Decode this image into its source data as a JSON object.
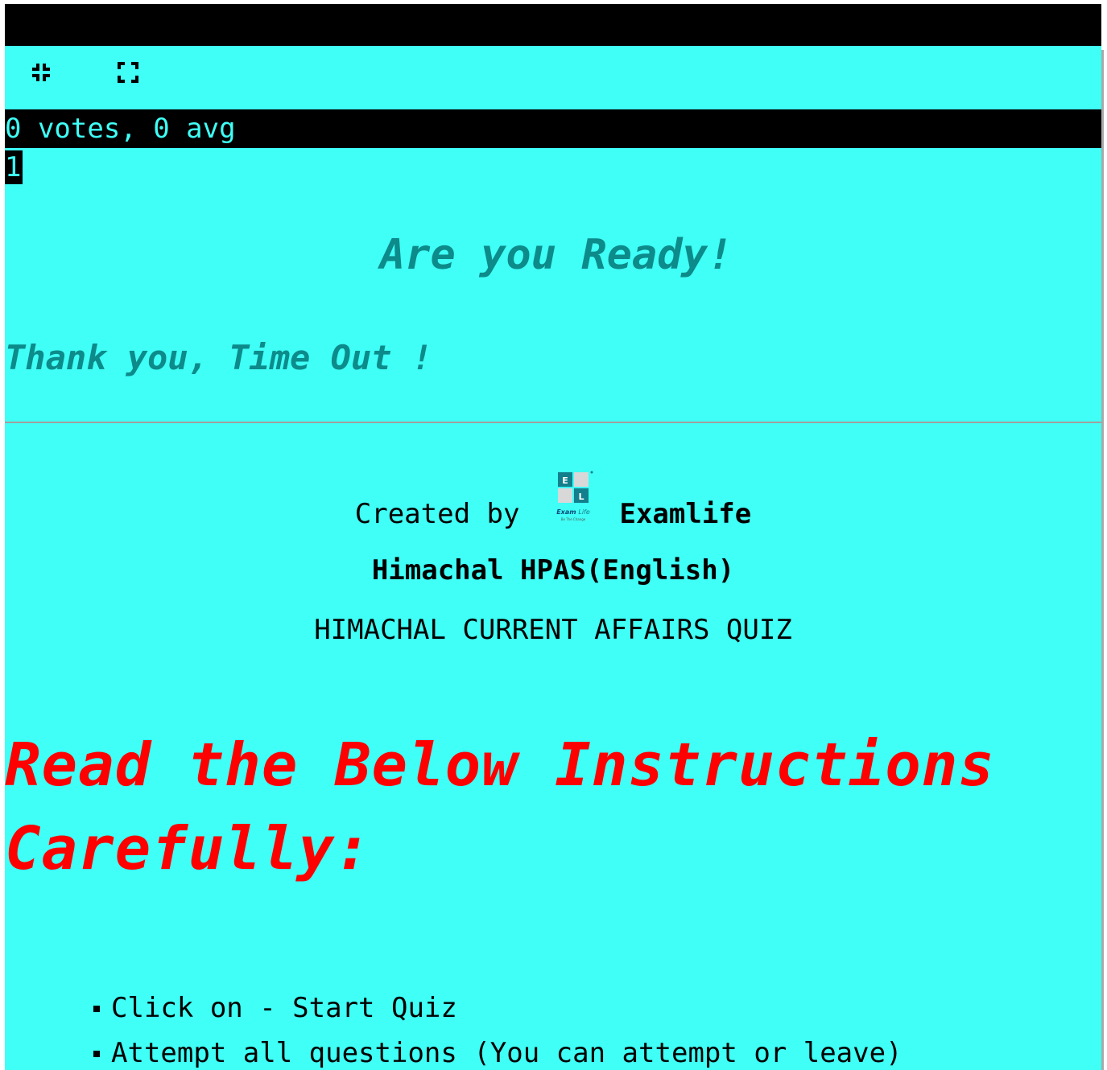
{
  "controls": {
    "exit_fullscreen_icon": "exit-fullscreen-icon",
    "fullscreen_icon": "fullscreen-icon"
  },
  "rating": {
    "text": "0 votes, 0 avg"
  },
  "counter": {
    "value": "1"
  },
  "messages": {
    "ready": "Are you Ready!",
    "timeout": "Thank you, Time Out !"
  },
  "creator": {
    "prefix": "Created by",
    "name": "Examlife",
    "group": "Himachal HPAS(English)",
    "logo": {
      "top_letter": "E",
      "bottom_letter": "L",
      "caption": "Exam Life",
      "tagline": "Be The Change"
    }
  },
  "quiz": {
    "title": "HIMACHAL CURRENT AFFAIRS QUIZ"
  },
  "instructions": {
    "heading": "Read the Below Instructions Carefully:",
    "items": [
      "Click on - Start Quiz",
      "Attempt all questions (You can attempt or leave)"
    ]
  },
  "colors": {
    "background": "#3ffff6",
    "bar": "#000000",
    "accent_teal": "#0d8a8a",
    "heading_red": "#ff0000"
  }
}
